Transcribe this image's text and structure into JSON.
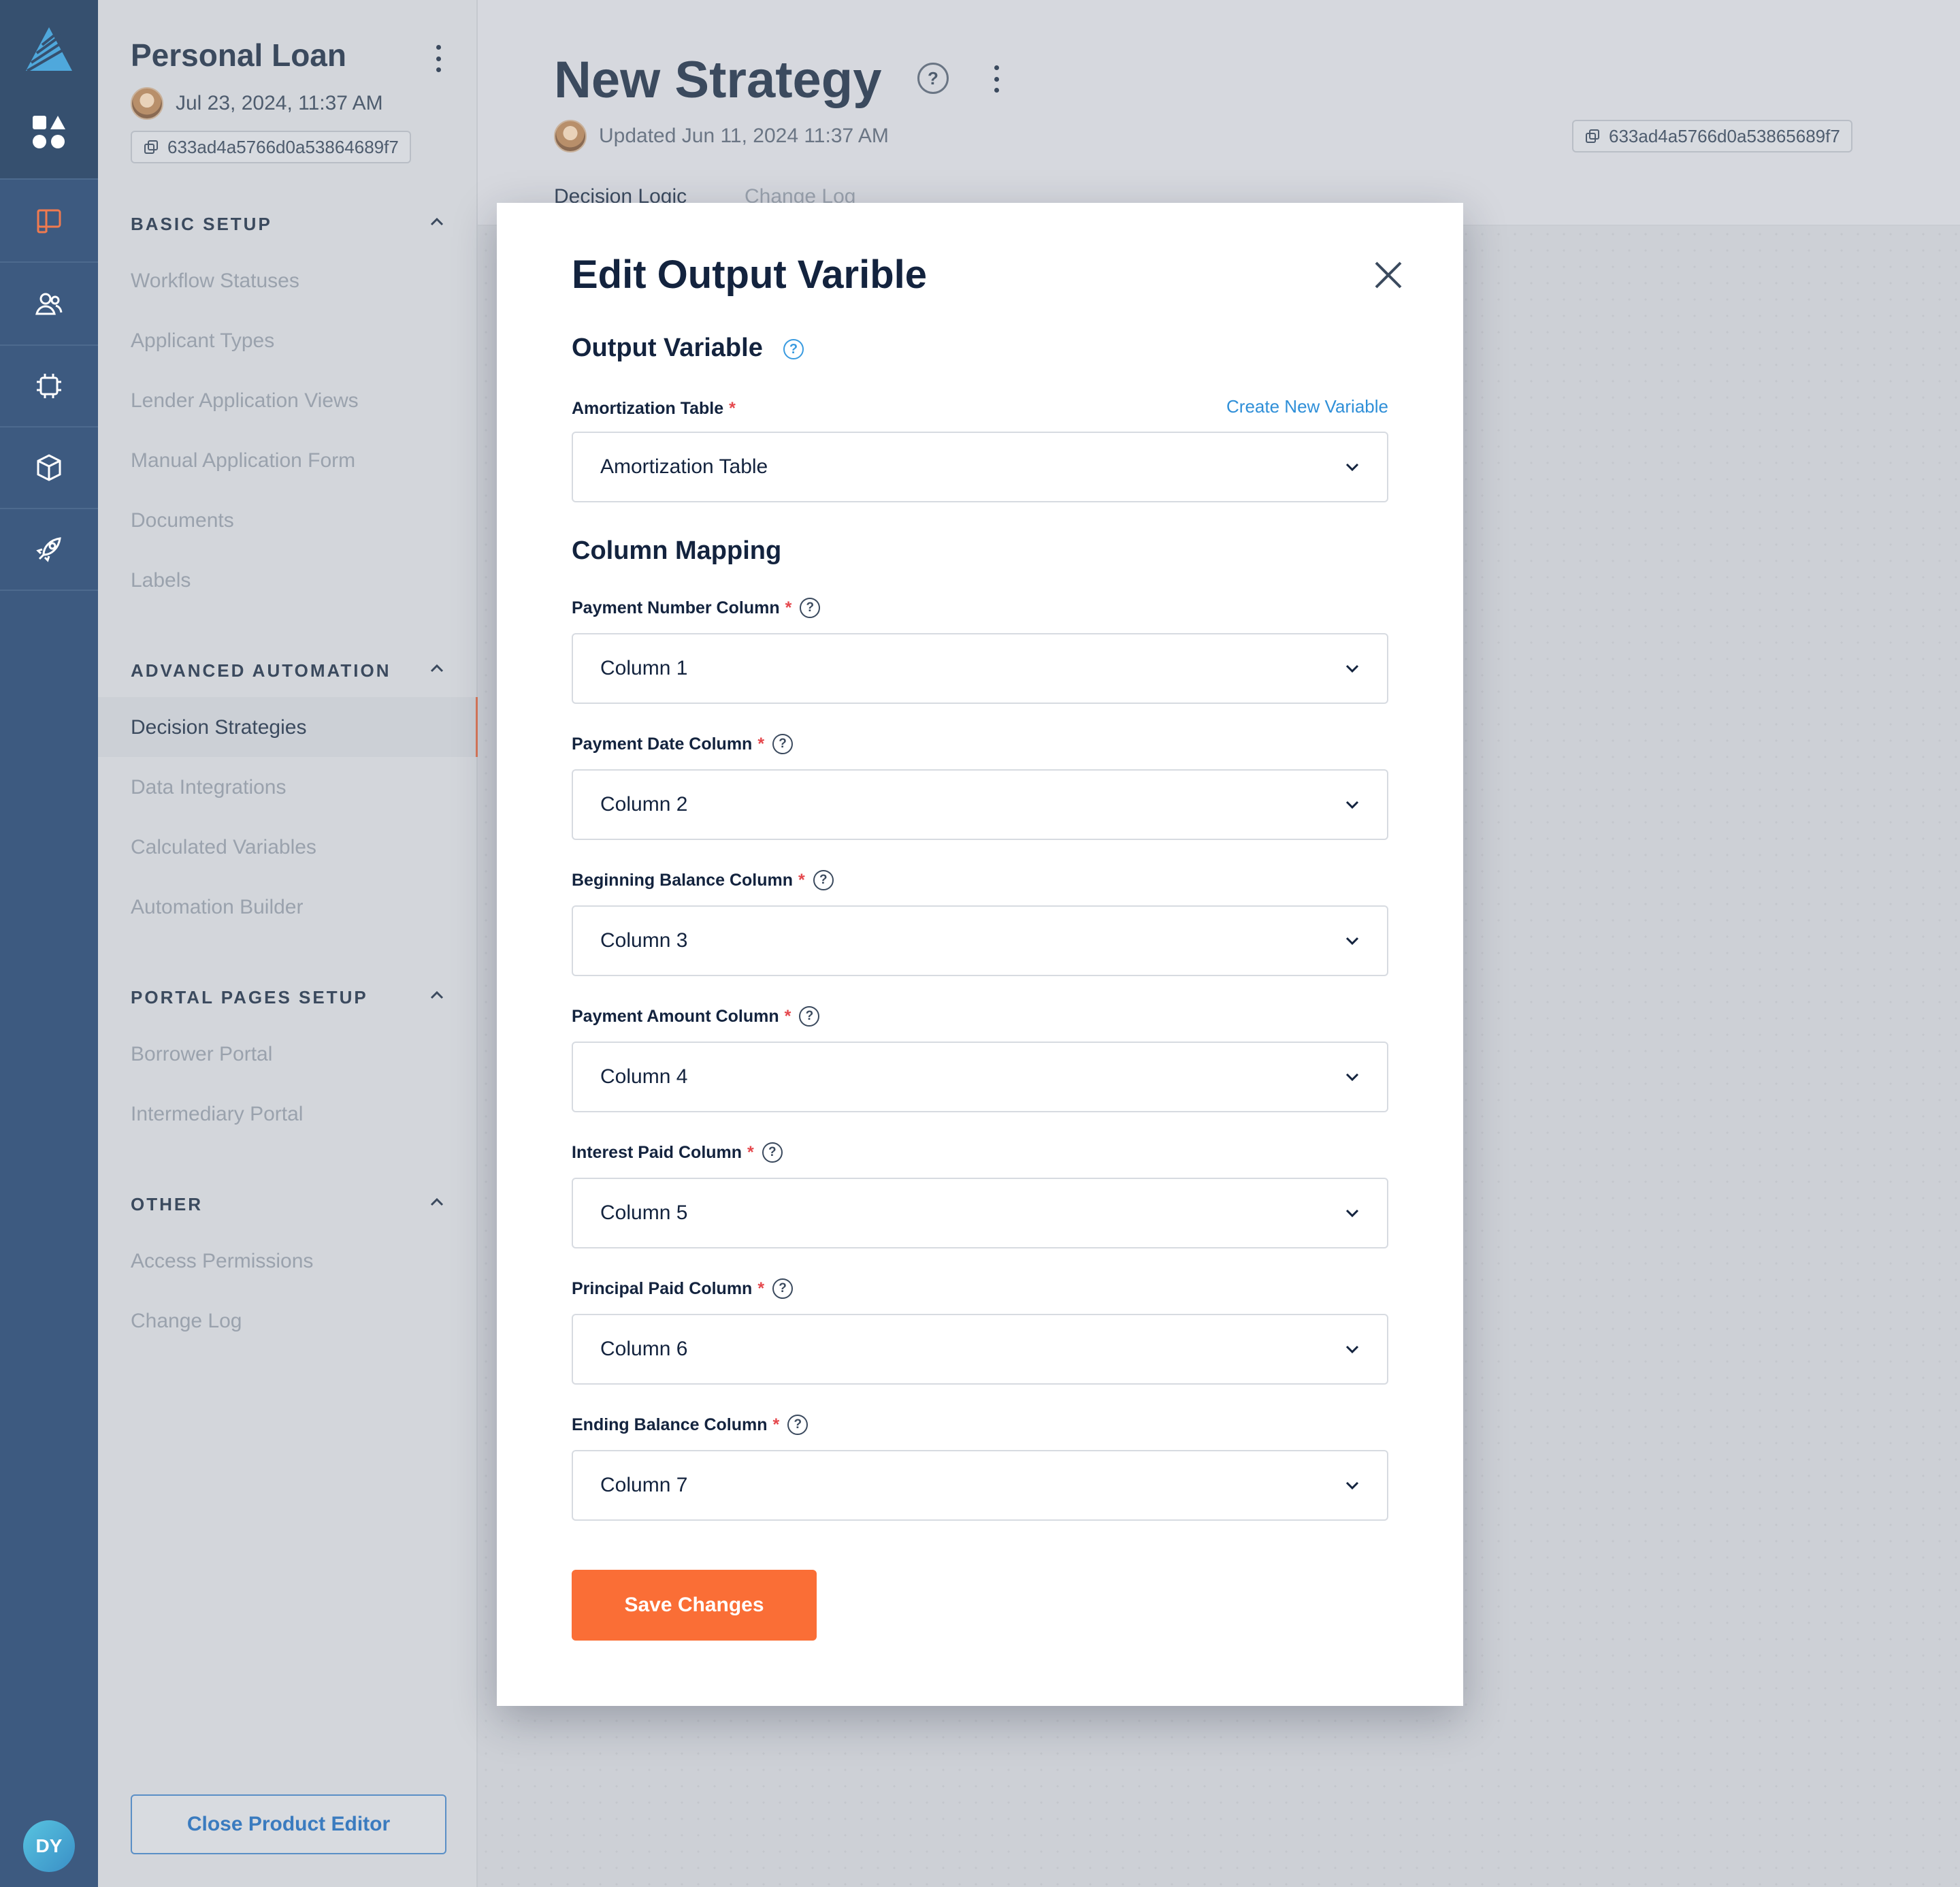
{
  "rail": {
    "user_initials": "DY",
    "accent": "#3d5a80",
    "items": [
      {
        "icon": "layout-icon"
      },
      {
        "icon": "users-icon"
      },
      {
        "icon": "chip-icon"
      },
      {
        "icon": "cube-icon"
      },
      {
        "icon": "rocket-icon"
      }
    ]
  },
  "product": {
    "title": "Personal Loan",
    "date": "Jul 23, 2024, 11:37 AM",
    "id": "633ad4a5766d0a53864689f7"
  },
  "sections": {
    "basic_setup": {
      "title": "BASIC SETUP",
      "items": [
        "Workflow Statuses",
        "Applicant Types",
        "Lender Application Views",
        "Manual Application Form",
        "Documents",
        "Labels"
      ]
    },
    "advanced_automation": {
      "title": "ADVANCED AUTOMATION",
      "items": [
        "Decision Strategies",
        "Data Integrations",
        "Calculated Variables",
        "Automation Builder"
      ]
    },
    "portal_pages_setup": {
      "title": "PORTAL PAGES SETUP",
      "items": [
        "Borrower Portal",
        "Intermediary Portal"
      ]
    },
    "other": {
      "title": "OTHER",
      "items": [
        "Access Permissions",
        "Change Log"
      ]
    }
  },
  "close_editor_label": "Close Product Editor",
  "strategy": {
    "title": "New Strategy",
    "help": "?",
    "updated": "Updated Jun 11, 2024 11:37 AM",
    "id": "633ad4a5766d0a53865689f7",
    "tabs": [
      "Decision Logic",
      "Change Log"
    ]
  },
  "modal": {
    "title": "Edit Output Varible",
    "output_heading": "Output Variable",
    "help": "?",
    "table_label": "Amortization Table",
    "create_link": "Create New Variable",
    "table_value": "Amortization Table",
    "mapping_heading": "Column Mapping",
    "required_mark": "*",
    "fields": [
      {
        "label": "Payment Number Column",
        "value": "Column 1"
      },
      {
        "label": "Payment Date Column",
        "value": "Column 2"
      },
      {
        "label": "Beginning Balance Column",
        "value": "Column 3"
      },
      {
        "label": "Payment Amount Column",
        "value": "Column 4"
      },
      {
        "label": "Interest Paid Column",
        "value": "Column 5"
      },
      {
        "label": "Principal Paid Column",
        "value": "Column 6"
      },
      {
        "label": "Ending Balance Column",
        "value": "Column 7"
      }
    ],
    "save_label": "Save Changes",
    "save_color": "#fa6e36"
  }
}
